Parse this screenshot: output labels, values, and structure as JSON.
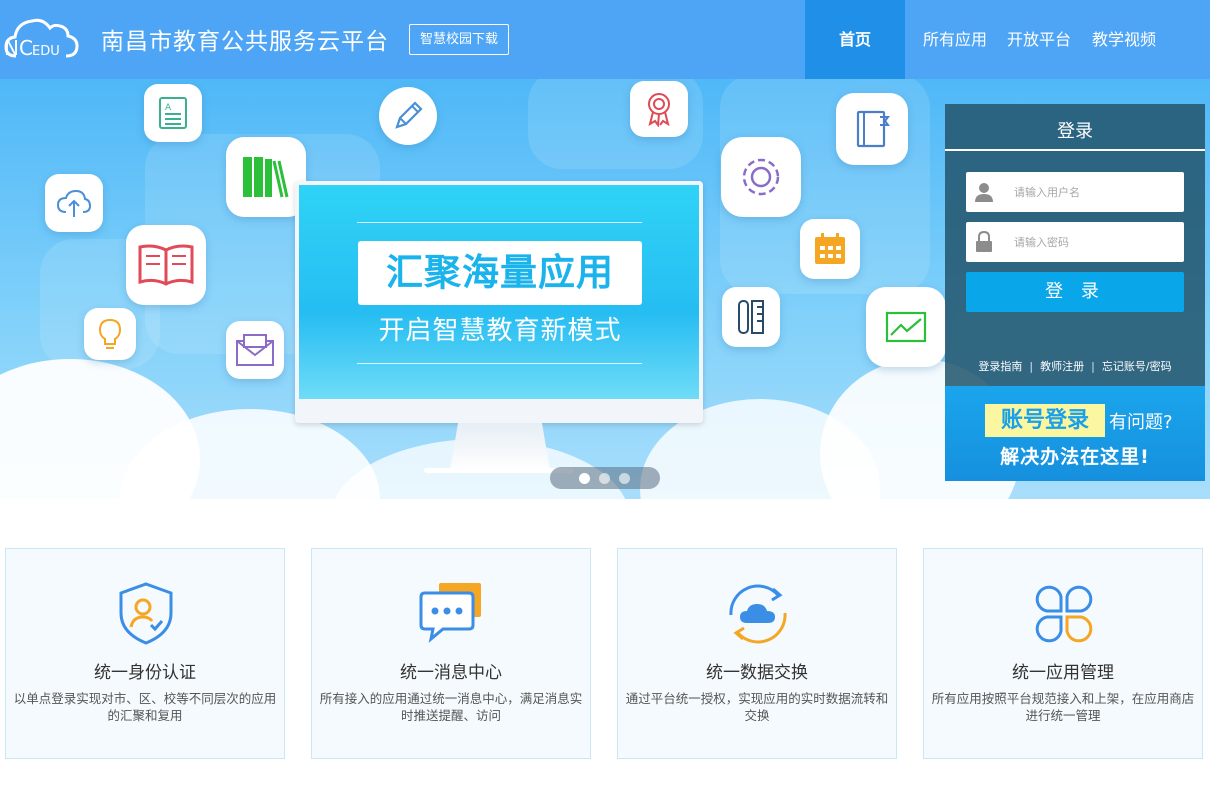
{
  "header": {
    "logo_text": "NCEDU",
    "site_title": "南昌市教育公共服务云平台",
    "download_button": "智慧校园下载",
    "nav": [
      {
        "label": "首页",
        "active": true
      },
      {
        "label": "所有应用",
        "active": false
      },
      {
        "label": "开放平台",
        "active": false
      },
      {
        "label": "教学视频",
        "active": false
      }
    ],
    "colors": {
      "header_bg": "#4ea5f5",
      "active_nav_bg": "#1f8fe8"
    }
  },
  "banner": {
    "headline": "汇聚海量应用",
    "subline": "开启智慧教育新模式",
    "slides": 3,
    "active_slide": 1,
    "icons": [
      "document-icon",
      "pencil-icon",
      "award-icon",
      "notebook-icon",
      "books-icon",
      "cloud-upload-icon",
      "open-book-icon",
      "gear-icon",
      "calendar-icon",
      "lightbulb-icon",
      "mail-icon",
      "pen-ruler-icon",
      "chart-icon"
    ]
  },
  "login": {
    "title": "登录",
    "username_placeholder": "请输入用户名",
    "password_placeholder": "请输入密码",
    "submit": "登 录",
    "links": [
      "登录指南",
      "教师注册",
      "忘记账号/密码"
    ]
  },
  "help": {
    "highlight": "账号登录",
    "question": "有问题?",
    "solution": "解决办法在这里!"
  },
  "features": [
    {
      "icon": "shield-user-icon",
      "title": "统一身份认证",
      "desc": "以单点登录实现对市、区、校等不同层次的应用的汇聚和复用"
    },
    {
      "icon": "chat-bubbles-icon",
      "title": "统一消息中心",
      "desc": "所有接入的应用通过统一消息中心，满足消息实时推送提醒、访问"
    },
    {
      "icon": "cloud-sync-icon",
      "title": "统一数据交换",
      "desc": "通过平台统一授权，实现应用的实时数据流转和交换"
    },
    {
      "icon": "app-grid-icon",
      "title": "统一应用管理",
      "desc": "所有应用按照平台规范接入和上架，在应用商店进行统一管理"
    }
  ]
}
